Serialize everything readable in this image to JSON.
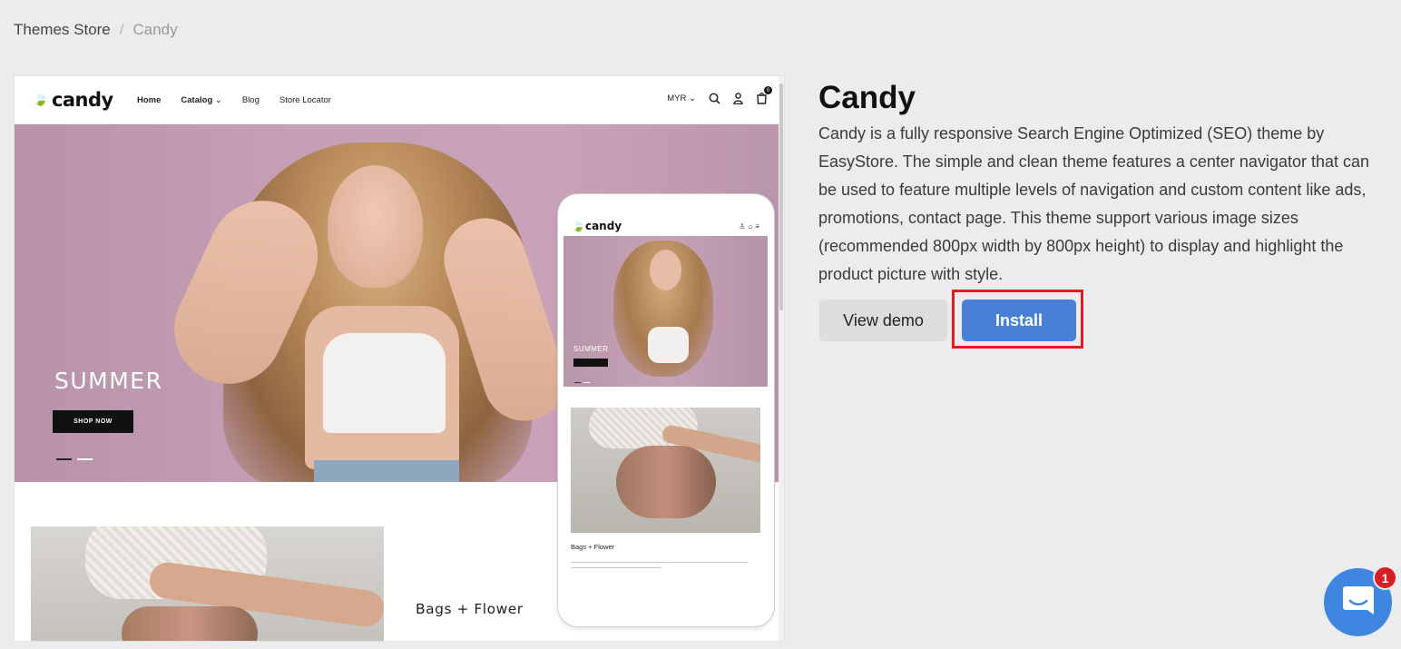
{
  "breadcrumb": {
    "root": "Themes Store",
    "separator": "/",
    "current": "Candy"
  },
  "preview": {
    "logo": "candy",
    "menu": [
      "Home",
      "Catalog",
      "Blog",
      "Store Locator"
    ],
    "currency": "MYR",
    "cart_count": "0",
    "hero_title": "SUMMER",
    "hero_button": "SHOP NOW",
    "section_title": "Bags + Flower",
    "phone": {
      "logo": "candy",
      "hero_title": "SUMMER",
      "section_title": "Bags + Flower"
    }
  },
  "theme": {
    "title": "Candy",
    "description": "Candy is a fully responsive Search Engine Optimized (SEO) theme by EasyStore. The simple and clean theme features a center navigator that can be used to feature multiple levels of navigation and custom content like ads, promotions, contact page. This theme support various image sizes (recommended 800px width by 800px height) to display and highlight the product picture with style.",
    "view_demo_label": "View demo",
    "install_label": "Install"
  },
  "chat": {
    "badge_count": "1"
  },
  "colors": {
    "install": "#4a7fd6",
    "highlight": "#e01b24",
    "chat": "#3f86e0",
    "badge": "#d81e22"
  }
}
